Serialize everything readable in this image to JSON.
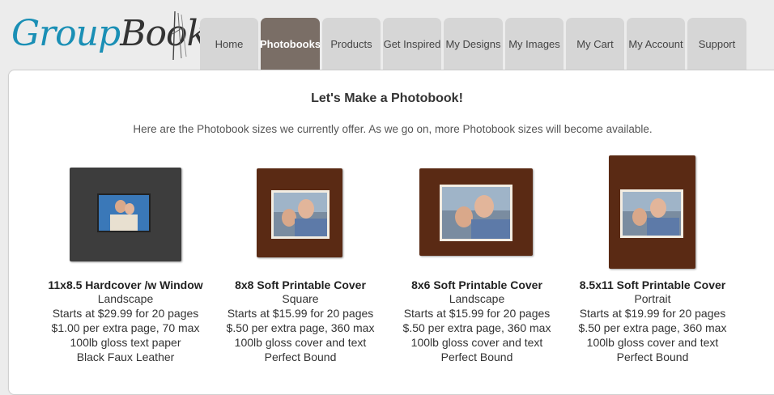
{
  "logo": {
    "text_part1": "Group",
    "text_part2": "Book"
  },
  "nav": {
    "tabs": [
      {
        "label": "Home",
        "active": false
      },
      {
        "label": "Photobooks",
        "active": true
      },
      {
        "label": "Products",
        "active": false
      },
      {
        "label": "Get Inspired",
        "active": false
      },
      {
        "label": "My Designs",
        "active": false
      },
      {
        "label": "My Images",
        "active": false
      },
      {
        "label": "My Cart",
        "active": false
      },
      {
        "label": "My Account",
        "active": false
      },
      {
        "label": "Support",
        "active": false
      }
    ]
  },
  "main": {
    "heading": "Let's Make a Photobook!",
    "subheading": "Here are the Photobook sizes we currently offer. As we go on, more Photobook sizes will become available."
  },
  "products": [
    {
      "title": "11x8.5 Hardcover /w Window",
      "orientation": "Landscape",
      "price": "Starts at $29.99 for 20 pages",
      "extra": "$1.00 per extra page, 70 max",
      "paper": "100lb gloss text paper",
      "binding": "Black Faux Leather",
      "cover_style": "black-leather"
    },
    {
      "title": "8x8 Soft Printable Cover",
      "orientation": "Square",
      "price": "Starts at $15.99 for 20 pages",
      "extra": "$.50 per extra page, 360 max",
      "paper": "100lb gloss cover and text",
      "binding": "Perfect Bound",
      "cover_style": "brown-printed"
    },
    {
      "title": "8x6 Soft Printable Cover",
      "orientation": "Landscape",
      "price": "Starts at $15.99 for 20 pages",
      "extra": "$.50 per extra page, 360 max",
      "paper": "100lb gloss cover and text",
      "binding": "Perfect Bound",
      "cover_style": "brown-printed"
    },
    {
      "title": "8.5x11 Soft Printable Cover",
      "orientation": "Portrait",
      "price": "Starts at $19.99 for 20 pages",
      "extra": "$.50 per extra page, 360 max",
      "paper": "100lb gloss cover and text",
      "binding": "Perfect Bound",
      "cover_style": "brown-printed"
    }
  ],
  "colors": {
    "brand_blue": "#1a8fb5",
    "active_tab": "#7a6e66",
    "inactive_tab": "#d6d6d6",
    "cover_brown": "#5a2a14",
    "cover_black": "#3a3a3a"
  }
}
